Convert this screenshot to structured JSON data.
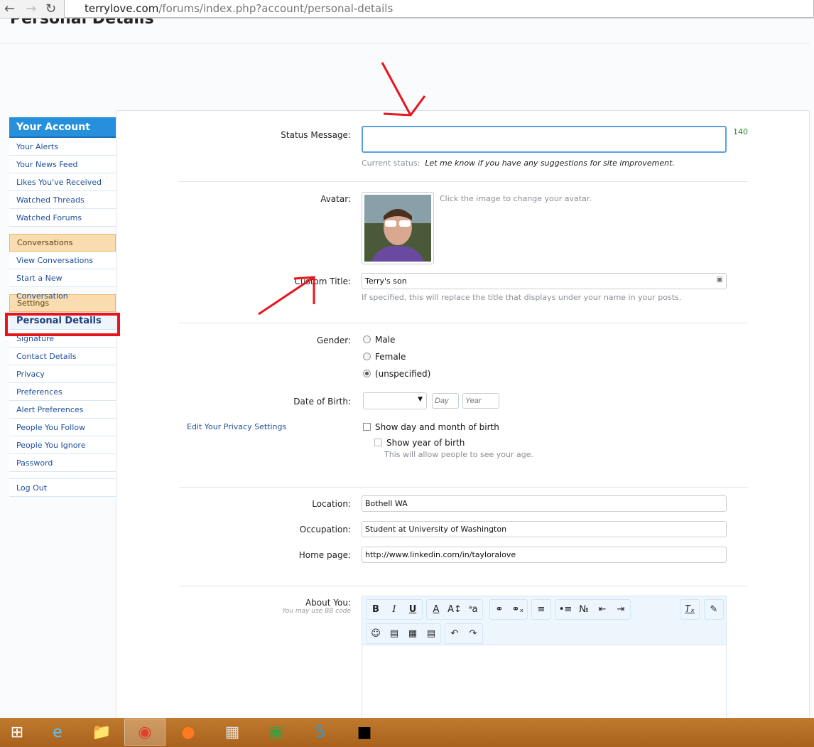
{
  "browser": {
    "url_host": "terrylove.com",
    "url_path": "/forums/index.php?account/personal-details"
  },
  "page": {
    "title": "Personal Details"
  },
  "sidebar": {
    "header": "Your Account",
    "account_items": [
      "Your Alerts",
      "Your News Feed",
      "Likes You've Received",
      "Watched Threads",
      "Watched Forums"
    ],
    "conversations_header": "Conversations",
    "conversation_items": [
      "View Conversations",
      "Start a New Conversation"
    ],
    "settings_header": "Settings",
    "settings_items": [
      "Personal Details",
      "Signature",
      "Contact Details",
      "Privacy",
      "Preferences",
      "Alert Preferences",
      "People You Follow",
      "People You Ignore",
      "Password"
    ],
    "logout": "Log Out"
  },
  "form": {
    "status_label": "Status Message:",
    "status_value": "",
    "status_counter": "140",
    "current_status_label": "Current status:",
    "current_status": "Let me know if you have any suggestions for site improvement.",
    "avatar_label": "Avatar:",
    "avatar_hint": "Click the image to change your avatar.",
    "custom_title_label": "Custom Title:",
    "custom_title_value": "Terry's son",
    "custom_title_hint": "If specified, this will replace the title that displays under your name in your posts.",
    "gender_label": "Gender:",
    "gender_options": [
      "Male",
      "Female",
      "(unspecified)"
    ],
    "gender_selected": "(unspecified)",
    "dob_label": "Date of Birth:",
    "dob_month": "",
    "dob_day_placeholder": "Day",
    "dob_year_placeholder": "Year",
    "privacy_link": "Edit Your Privacy Settings",
    "show_dob": "Show day and month of birth",
    "show_year": "Show year of birth",
    "show_year_hint": "This will allow people to see your age.",
    "location_label": "Location:",
    "location_value": "Bothell WA",
    "occupation_label": "Occupation:",
    "occupation_value": "Student at University of Washington",
    "homepage_label": "Home page:",
    "homepage_value": "http://www.linkedin.com/in/tayloralove",
    "about_label": "About You:",
    "about_hint": "You may use BB code"
  },
  "editor_icons": [
    "bold-icon",
    "italic-icon",
    "underline-icon",
    "font-color-icon",
    "font-size-icon",
    "font-family-icon",
    "link-icon",
    "unlink-icon",
    "align-icon",
    "bullet-list-icon",
    "numbered-list-icon",
    "outdent-icon",
    "indent-icon",
    "remove-format-icon",
    "bbcode-toggle-icon",
    "smilie-icon",
    "image-icon",
    "media-icon",
    "code-icon",
    "undo-icon",
    "redo-icon"
  ],
  "taskbar": [
    "start",
    "internet-explorer",
    "file-explorer",
    "chrome",
    "firefox",
    "calculator",
    "store",
    "skype",
    "command-prompt"
  ],
  "colors": {
    "accent": "#2690dc",
    "annotation": "#e8141c",
    "counter": "#2a8a2a"
  }
}
